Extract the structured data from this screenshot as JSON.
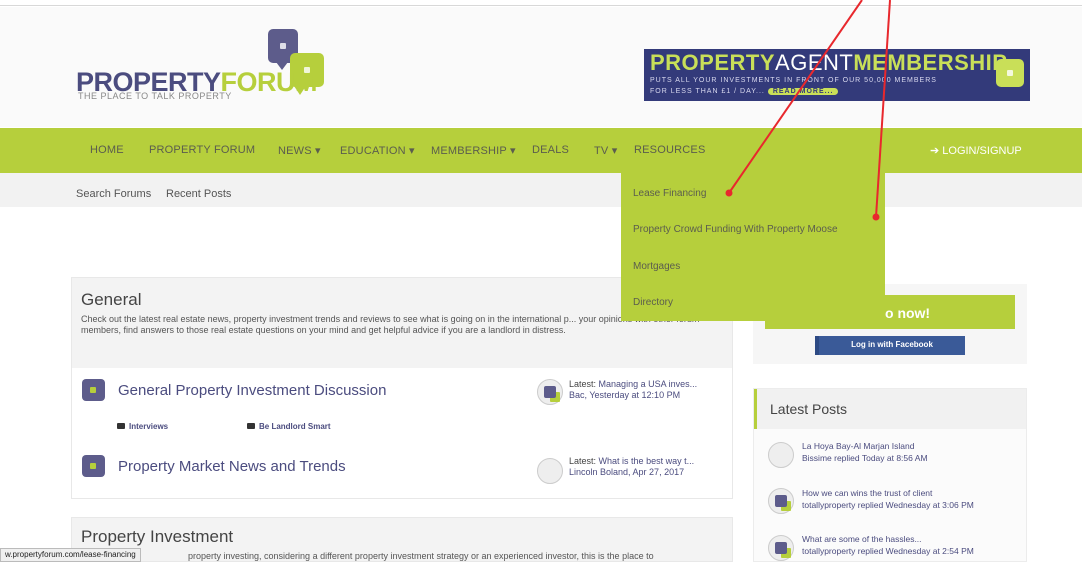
{
  "header": {
    "logo_primary": "PROPERTY",
    "logo_accent": "FORUM",
    "logo_tagline": "THE PLACE TO TALK PROPERTY",
    "banner": {
      "title_a": "PROPERTY",
      "title_b": "AGENT",
      "title_c": "MEMBERSHIP",
      "line1": "PUTS ALL YOUR INVESTMENTS IN FRONT OF OUR 50,000 MEMBERS",
      "line2": "FOR LESS THAN £1 / DAY...",
      "read_more": "READ MORE..."
    }
  },
  "nav": {
    "items": [
      "HOME",
      "PROPERTY FORUM",
      "NEWS ▾",
      "EDUCATION ▾",
      "MEMBERSHIP ▾",
      "DEALS",
      "TV ▾",
      "RESOURCES"
    ],
    "login": "➔ LOGIN/SIGNUP"
  },
  "subnav": {
    "search": "Search Forums",
    "recent": "Recent Posts"
  },
  "resources_menu": {
    "items": [
      "Lease Financing",
      "Property Crowd Funding With Property Moose",
      "Mortgages",
      "Directory"
    ]
  },
  "general": {
    "title": "General",
    "description": "Check out the latest real estate news, property investment trends and reviews to see what is going on in the international p... your opinions with other forum members, find answers to those real estate questions on your mind and get helpful advice if you are a landlord in distress.",
    "forums": [
      {
        "title": "General Property Investment Discussion",
        "latest_label": "Latest:",
        "latest_thread": "Managing a USA inves...",
        "latest_meta": "Bac, Yesterday at 12:10 PM",
        "subforums": [
          "Interviews",
          "Be Landlord Smart"
        ]
      },
      {
        "title": "Property Market News and Trends",
        "latest_label": "Latest:",
        "latest_thread": "What is the best way t...",
        "latest_meta": "Lincoln Boland, Apr 27, 2017",
        "subforums": []
      }
    ]
  },
  "investment": {
    "title": "Property Investment",
    "description_fragment": "property investing, considering a different property investment strategy or an experienced investor, this is the place to"
  },
  "sidebar": {
    "join_text": "o now!",
    "facebook_button": "Log in with Facebook",
    "latest_posts_title": "Latest Posts",
    "posts": [
      {
        "title": "La Hoya Bay-Al Marjan Island",
        "meta": "Bissime replied Today at 8:56 AM"
      },
      {
        "title": "How we can wins the trust of client",
        "meta": "totallyproperty replied Wednesday at 3:06 PM"
      },
      {
        "title": "What are some of the hassles...",
        "meta": "totallyproperty replied Wednesday at 2:54 PM"
      }
    ]
  },
  "status_bar": {
    "url": "w.propertyforum.com/lease-financing"
  },
  "colors": {
    "brand_green": "#b6cf3c",
    "brand_purple": "#4b4c7f",
    "banner_navy": "#333a7a",
    "facebook_blue": "#3a5a98",
    "annotation_red": "#e8282d"
  }
}
